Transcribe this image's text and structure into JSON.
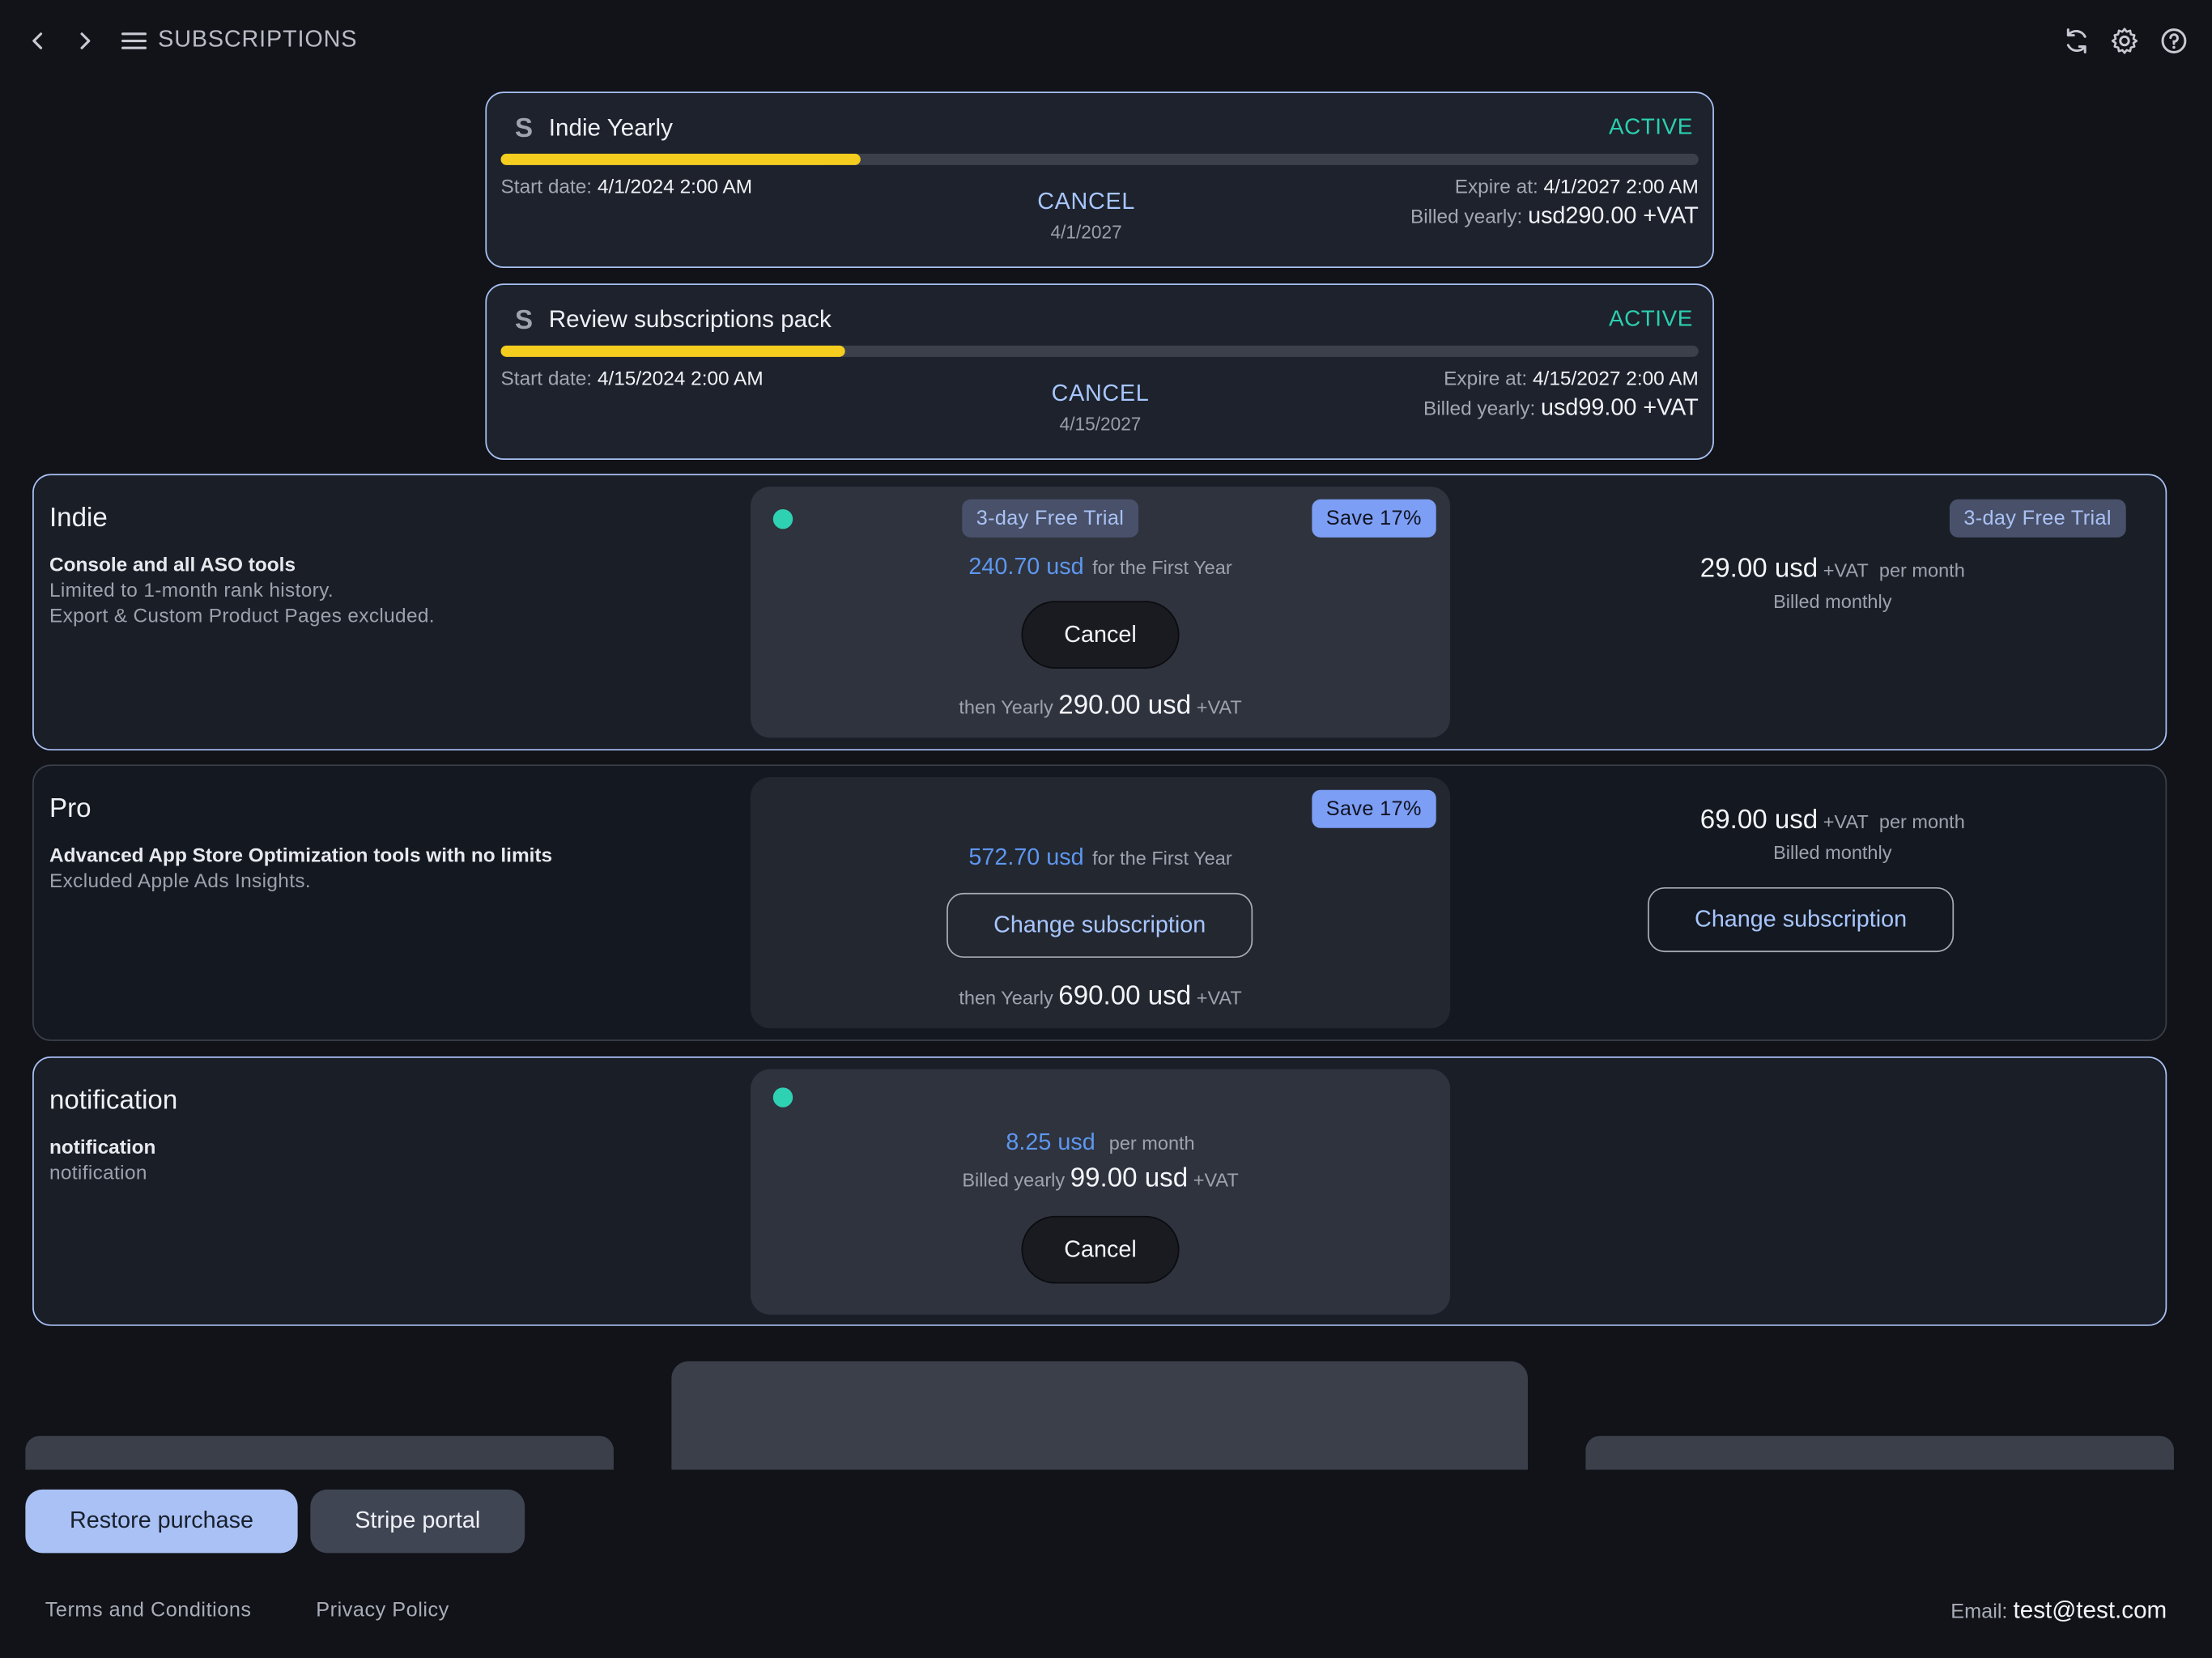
{
  "header": {
    "back_icon": "chevron-left",
    "forward_icon": "chevron-right",
    "menu_icon": "menu",
    "title": "SUBSCRIPTIONS",
    "refresh_icon": "refresh",
    "settings_icon": "gear",
    "help_icon": "help-circle"
  },
  "active_subscriptions": [
    {
      "icon": "S",
      "name": "Indie Yearly",
      "status": "ACTIVE",
      "progress": 0.3,
      "start_label": "Start date:",
      "start_value": "4/1/2024 2:00 AM",
      "cancel_label": "CANCEL",
      "cancel_date": "4/1/2027",
      "expire_label": "Expire at:",
      "expire_value": "4/1/2027 2:00 AM",
      "billed_label": "Billed yearly:",
      "billed_value": "usd290.00 +VAT"
    },
    {
      "icon": "S",
      "name": "Review subscriptions pack",
      "status": "ACTIVE",
      "progress": 0.287,
      "start_label": "Start date:",
      "start_value": "4/15/2024 2:00 AM",
      "cancel_label": "CANCEL",
      "cancel_date": "4/15/2027",
      "expire_label": "Expire at:",
      "expire_value": "4/15/2027 2:00 AM",
      "billed_label": "Billed yearly:",
      "billed_value": "usd99.00 +VAT"
    }
  ],
  "plans": {
    "indie": {
      "name": "Indie",
      "desc": "Console and all ASO tools",
      "sub1": "Limited to 1-month rank history.",
      "sub2": "Export & Custom Product Pages excluded.",
      "yearly": {
        "trial_chip": "3-day Free Trial",
        "save_chip": "Save 17%",
        "first_price": "240.70 usd",
        "first_suffix": "for the First Year",
        "button": "Cancel",
        "then_label": "then Yearly",
        "then_price": "290.00 usd",
        "vat": "+VAT"
      },
      "monthly": {
        "trial_chip": "3-day Free Trial",
        "price": "29.00 usd",
        "vat": "+VAT",
        "per": "per month",
        "billed": "Billed monthly"
      }
    },
    "pro": {
      "name": "Pro",
      "desc": "Advanced App Store Optimization tools with no limits",
      "sub1": "Excluded Apple Ads Insights.",
      "yearly": {
        "save_chip": "Save 17%",
        "first_price": "572.70 usd",
        "first_suffix": "for the First Year",
        "button": "Change subscription",
        "then_label": "then Yearly",
        "then_price": "690.00 usd",
        "vat": "+VAT"
      },
      "monthly": {
        "price": "69.00 usd",
        "vat": "+VAT",
        "per": "per month",
        "billed": "Billed monthly",
        "button": "Change subscription"
      }
    },
    "notification": {
      "name": "notification",
      "desc": "notification",
      "sub1": "notification",
      "yearly": {
        "price": "8.25 usd",
        "per": "per month",
        "billed_label": "Billed yearly",
        "billed_price": "99.00 usd",
        "vat": "+VAT",
        "button": "Cancel"
      }
    }
  },
  "actions": {
    "restore": "Restore purchase",
    "stripe": "Stripe portal"
  },
  "footer": {
    "terms": "Terms and Conditions",
    "privacy": "Privacy Policy",
    "email_label": "Email:",
    "email_value": "test@test.com"
  },
  "colors": {
    "background": "#111318",
    "accent": "#a9c1f4",
    "active_status": "#2bd0b0",
    "progress": "#f5cd1f",
    "price_blue": "#5d97ef"
  }
}
